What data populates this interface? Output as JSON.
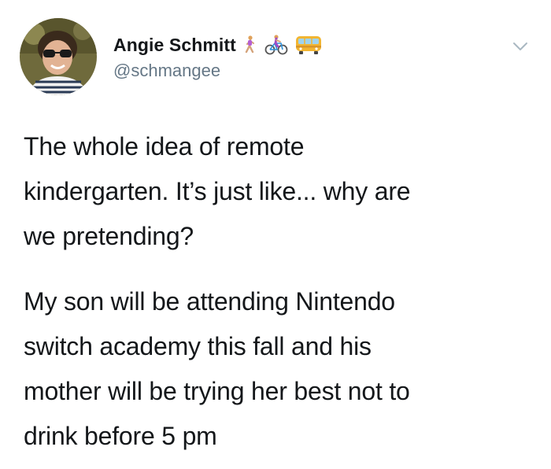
{
  "author": {
    "display_name": "Angie Schmitt",
    "handle": "@schmangee",
    "avatar_icon": "profile-photo",
    "name_emojis": [
      "person-walking-icon",
      "person-biking-icon",
      "bus-icon"
    ]
  },
  "tweet": {
    "paragraph_1": "The whole idea of remote\nkindergarten. It’s just like... why are\nwe pretending?",
    "paragraph_2": "My son will be attending Nintendo\nswitch academy this fall and his\nmother will be trying her best not to\ndrink before 5 pm"
  },
  "menu": {
    "icon": "chevron-down-icon"
  },
  "colors": {
    "text": "#14171a",
    "secondary": "#657786",
    "chevron": "#aab8c2",
    "background": "#ffffff"
  }
}
